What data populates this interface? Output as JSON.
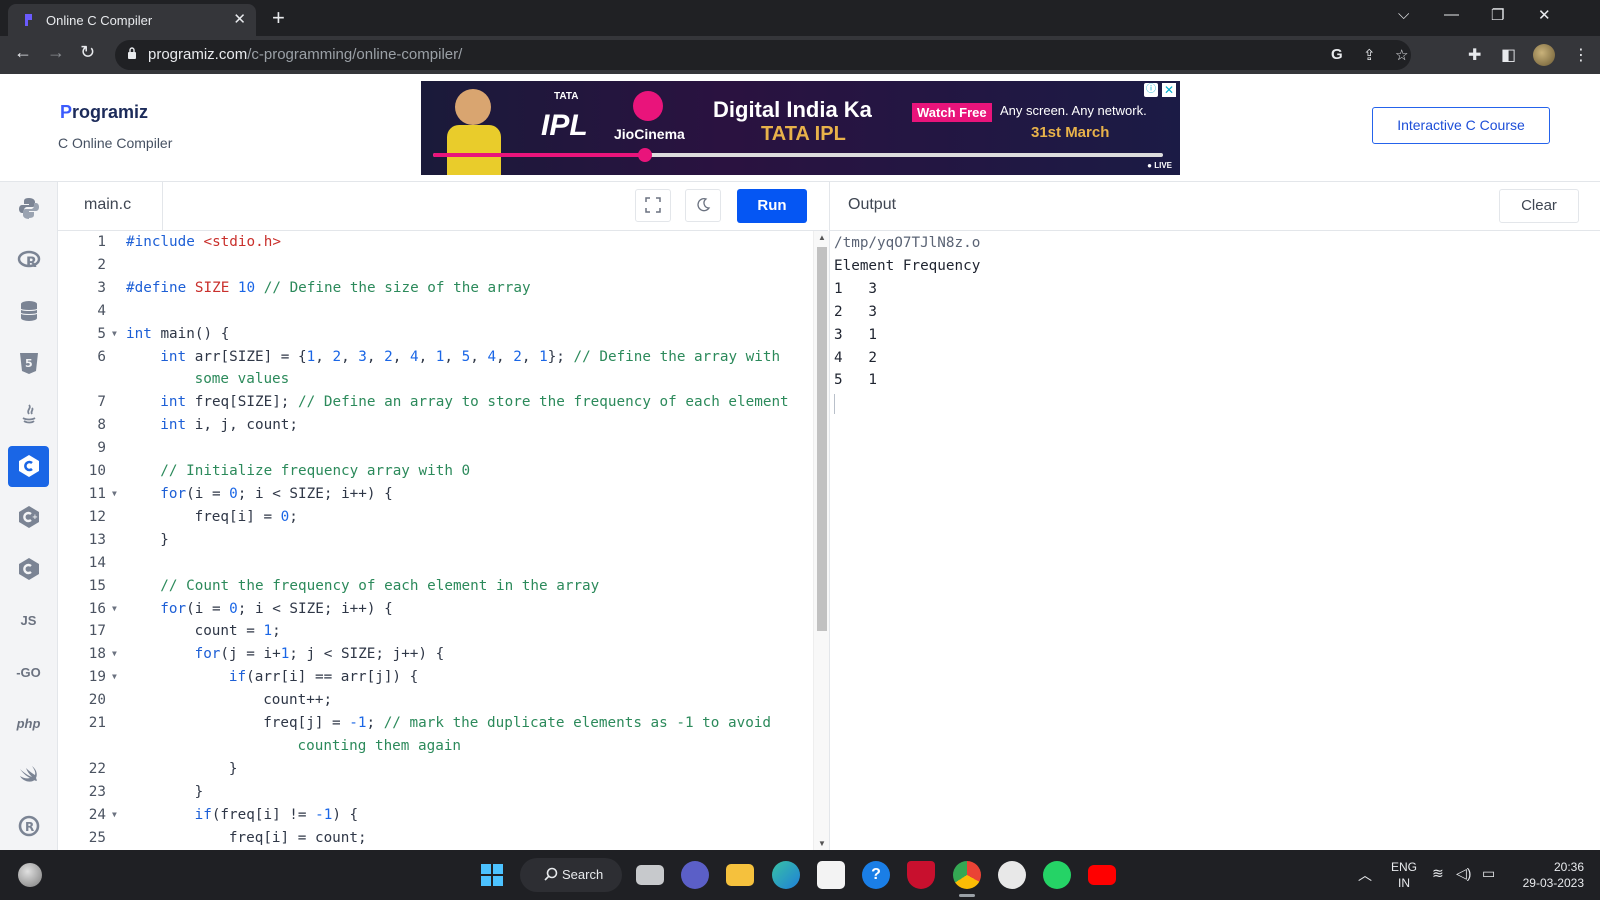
{
  "browser": {
    "tab_title": "Online C Compiler",
    "tab_close": "✕",
    "new_tab": "+",
    "url_domain": "programiz.com",
    "url_path": "/c-programming/online-compiler/",
    "window_controls": [
      "⌵",
      "—",
      "❐",
      "✕"
    ]
  },
  "site": {
    "logo_text": "rogramiz",
    "logo_initial": "P",
    "subtitle": "C Online Compiler",
    "course_button": "Interactive C Course"
  },
  "ad": {
    "tata": "TATA",
    "ipl": "IPL",
    "brand": "JioCinema",
    "headline": "Digital India Ka",
    "sub_headline": "TATA IPL",
    "watch_label": "Watch Free",
    "tagline": "Any screen. Any network.",
    "date": "31st March",
    "live": "● LIVE",
    "info": "ⓘ",
    "close": "✕",
    "progress_fraction": 0.29
  },
  "rail": {
    "items": [
      {
        "name": "python",
        "label": ""
      },
      {
        "name": "r",
        "label": ""
      },
      {
        "name": "sql",
        "label": ""
      },
      {
        "name": "html",
        "label": ""
      },
      {
        "name": "java",
        "label": ""
      },
      {
        "name": "c",
        "label": ""
      },
      {
        "name": "cpp",
        "label": ""
      },
      {
        "name": "csharp",
        "label": ""
      },
      {
        "name": "js",
        "label": "JS"
      },
      {
        "name": "go",
        "label": "-GO"
      },
      {
        "name": "php",
        "label": "php"
      },
      {
        "name": "swift",
        "label": ""
      },
      {
        "name": "rust",
        "label": ""
      }
    ],
    "active_index": 5
  },
  "editor": {
    "file_name": "main.c",
    "run_label": "Run",
    "lines": [
      {
        "n": "1",
        "fold": false,
        "indent": 0,
        "tokens": [
          [
            "kw",
            "#include "
          ],
          [
            "str",
            "<stdio.h>"
          ]
        ]
      },
      {
        "n": "2",
        "fold": false,
        "indent": 0,
        "tokens": []
      },
      {
        "n": "3",
        "fold": false,
        "indent": 0,
        "tokens": [
          [
            "kw",
            "#define "
          ],
          [
            "str",
            "SIZE "
          ],
          [
            "num",
            "10 "
          ],
          [
            "com",
            "// Define the size of the array"
          ]
        ]
      },
      {
        "n": "4",
        "fold": false,
        "indent": 0,
        "tokens": []
      },
      {
        "n": "5",
        "fold": true,
        "indent": 0,
        "tokens": [
          [
            "kw",
            "int "
          ],
          [
            "pl",
            "main() {"
          ]
        ]
      },
      {
        "n": "6",
        "fold": false,
        "indent": 1,
        "tokens": [
          [
            "kw",
            "int "
          ],
          [
            "pl",
            "arr[SIZE] = {"
          ],
          [
            "num",
            "1"
          ],
          [
            "pl",
            ", "
          ],
          [
            "num",
            "2"
          ],
          [
            "pl",
            ", "
          ],
          [
            "num",
            "3"
          ],
          [
            "pl",
            ", "
          ],
          [
            "num",
            "2"
          ],
          [
            "pl",
            ", "
          ],
          [
            "num",
            "4"
          ],
          [
            "pl",
            ", "
          ],
          [
            "num",
            "1"
          ],
          [
            "pl",
            ", "
          ],
          [
            "num",
            "5"
          ],
          [
            "pl",
            ", "
          ],
          [
            "num",
            "4"
          ],
          [
            "pl",
            ", "
          ],
          [
            "num",
            "2"
          ],
          [
            "pl",
            ", "
          ],
          [
            "num",
            "1"
          ],
          [
            "pl",
            "}; "
          ],
          [
            "com",
            "// Define the array with"
          ]
        ]
      },
      {
        "n": "",
        "fold": false,
        "indent": 2,
        "tokens": [
          [
            "com",
            "some values"
          ]
        ]
      },
      {
        "n": "7",
        "fold": false,
        "indent": 1,
        "tokens": [
          [
            "kw",
            "int "
          ],
          [
            "pl",
            "freq[SIZE]; "
          ],
          [
            "com",
            "// Define an array to store the frequency of each element"
          ]
        ]
      },
      {
        "n": "8",
        "fold": false,
        "indent": 1,
        "tokens": [
          [
            "kw",
            "int "
          ],
          [
            "pl",
            "i, j, count;"
          ]
        ]
      },
      {
        "n": "9",
        "fold": false,
        "indent": 0,
        "tokens": []
      },
      {
        "n": "10",
        "fold": false,
        "indent": 1,
        "tokens": [
          [
            "com",
            "// Initialize frequency array with 0"
          ]
        ]
      },
      {
        "n": "11",
        "fold": true,
        "indent": 1,
        "tokens": [
          [
            "kw",
            "for"
          ],
          [
            "pl",
            "(i = "
          ],
          [
            "num",
            "0"
          ],
          [
            "pl",
            "; i < SIZE; i++) {"
          ]
        ]
      },
      {
        "n": "12",
        "fold": false,
        "indent": 2,
        "tokens": [
          [
            "pl",
            "freq[i] = "
          ],
          [
            "num",
            "0"
          ],
          [
            "pl",
            ";"
          ]
        ]
      },
      {
        "n": "13",
        "fold": false,
        "indent": 1,
        "tokens": [
          [
            "pl",
            "}"
          ]
        ]
      },
      {
        "n": "14",
        "fold": false,
        "indent": 0,
        "tokens": []
      },
      {
        "n": "15",
        "fold": false,
        "indent": 1,
        "tokens": [
          [
            "com",
            "// Count the frequency of each element in the array"
          ]
        ]
      },
      {
        "n": "16",
        "fold": true,
        "indent": 1,
        "tokens": [
          [
            "kw",
            "for"
          ],
          [
            "pl",
            "(i = "
          ],
          [
            "num",
            "0"
          ],
          [
            "pl",
            "; i < SIZE; i++) {"
          ]
        ]
      },
      {
        "n": "17",
        "fold": false,
        "indent": 2,
        "tokens": [
          [
            "pl",
            "count = "
          ],
          [
            "num",
            "1"
          ],
          [
            "pl",
            ";"
          ]
        ]
      },
      {
        "n": "18",
        "fold": true,
        "indent": 2,
        "tokens": [
          [
            "kw",
            "for"
          ],
          [
            "pl",
            "(j = i+"
          ],
          [
            "num",
            "1"
          ],
          [
            "pl",
            "; j < SIZE; j++) {"
          ]
        ]
      },
      {
        "n": "19",
        "fold": true,
        "indent": 3,
        "tokens": [
          [
            "kw",
            "if"
          ],
          [
            "pl",
            "(arr[i] == arr[j]) {"
          ]
        ]
      },
      {
        "n": "20",
        "fold": false,
        "indent": 4,
        "tokens": [
          [
            "pl",
            "count++;"
          ]
        ]
      },
      {
        "n": "21",
        "fold": false,
        "indent": 4,
        "tokens": [
          [
            "pl",
            "freq[j] = "
          ],
          [
            "num",
            "-1"
          ],
          [
            "pl",
            "; "
          ],
          [
            "com",
            "// mark the duplicate elements as -1 to avoid"
          ]
        ]
      },
      {
        "n": "",
        "fold": false,
        "indent": 5,
        "tokens": [
          [
            "com",
            "counting them again"
          ]
        ]
      },
      {
        "n": "22",
        "fold": false,
        "indent": 3,
        "tokens": [
          [
            "pl",
            "}"
          ]
        ]
      },
      {
        "n": "23",
        "fold": false,
        "indent": 2,
        "tokens": [
          [
            "pl",
            "}"
          ]
        ]
      },
      {
        "n": "24",
        "fold": true,
        "indent": 2,
        "tokens": [
          [
            "kw",
            "if"
          ],
          [
            "pl",
            "(freq[i] != "
          ],
          [
            "num",
            "-1"
          ],
          [
            "pl",
            ") {"
          ]
        ]
      },
      {
        "n": "25",
        "fold": false,
        "indent": 3,
        "tokens": [
          [
            "pl",
            "freq[i] = count;"
          ]
        ]
      }
    ]
  },
  "output": {
    "title": "Output",
    "clear_label": "Clear",
    "lines": [
      "/tmp/yqO7TJlN8z.o",
      "Element Frequency",
      "1   3",
      "2   3",
      "3   1",
      "4   2",
      "5   1"
    ]
  },
  "taskbar": {
    "search_label": "Search",
    "lang_top": "ENG",
    "lang_bottom": "IN",
    "time": "20:36",
    "date": "29-03-2023"
  },
  "colors": {
    "accent": "#0556f3",
    "keyword": "#1d5fd6",
    "string": "#c9302c",
    "comment": "#2c8a5b"
  }
}
